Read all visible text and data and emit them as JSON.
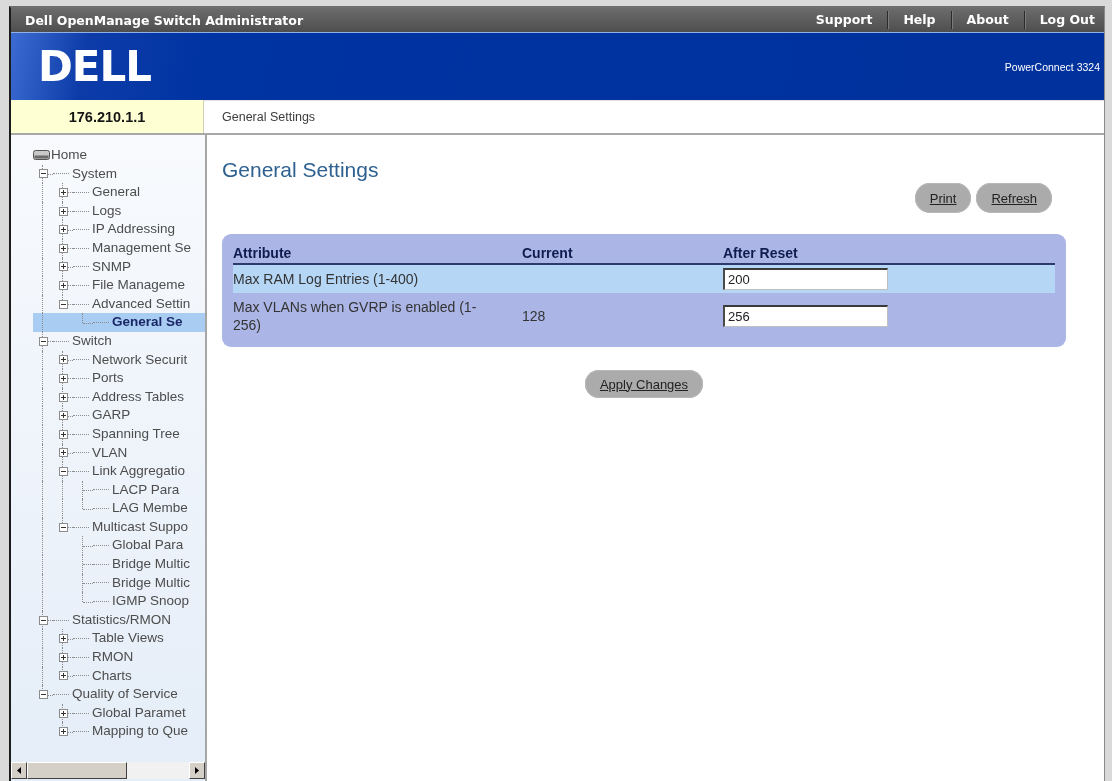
{
  "window": {
    "title": "Dell OpenManage Switch Administrator"
  },
  "header_links": [
    {
      "label": "Support"
    },
    {
      "label": "Help"
    },
    {
      "label": "About"
    },
    {
      "label": "Log Out"
    }
  ],
  "banner": {
    "logo": "DELL",
    "product": "PowerConnect 3324"
  },
  "address_bar": {
    "device": "176.210.1.1",
    "breadcrumb": "General Settings"
  },
  "sidebar": {
    "tree": [
      {
        "label": "Home",
        "selected": false,
        "children": [
          {
            "label": "System",
            "selected": false,
            "expanded": true,
            "children": [
              {
                "label": "General",
                "selected": false,
                "expanded": false
              },
              {
                "label": "Logs",
                "selected": false,
                "expanded": false
              },
              {
                "label": "IP Addressing",
                "selected": false,
                "expanded": false
              },
              {
                "label": "Management Se",
                "selected": false,
                "expanded": false
              },
              {
                "label": "SNMP",
                "selected": false,
                "expanded": false
              },
              {
                "label": "File Manageme",
                "selected": false,
                "expanded": false
              },
              {
                "label": "Advanced Settin",
                "selected": false,
                "expanded": true,
                "children": [
                  {
                    "label": "General Se",
                    "selected": true
                  }
                ]
              }
            ]
          },
          {
            "label": "Switch",
            "selected": false,
            "expanded": true,
            "children": [
              {
                "label": "Network Securit",
                "selected": false,
                "expanded": false
              },
              {
                "label": "Ports",
                "selected": false,
                "expanded": false
              },
              {
                "label": "Address Tables",
                "selected": false,
                "expanded": false
              },
              {
                "label": "GARP",
                "selected": false,
                "expanded": false
              },
              {
                "label": "Spanning Tree",
                "selected": false,
                "expanded": false
              },
              {
                "label": "VLAN",
                "selected": false,
                "expanded": false
              },
              {
                "label": "Link Aggregatio",
                "selected": false,
                "expanded": true,
                "children": [
                  {
                    "label": "LACP Para",
                    "selected": false
                  },
                  {
                    "label": "LAG Membe",
                    "selected": false
                  }
                ]
              },
              {
                "label": "Multicast Suppo",
                "selected": false,
                "expanded": true,
                "children": [
                  {
                    "label": "Global Para",
                    "selected": false
                  },
                  {
                    "label": "Bridge Multic",
                    "selected": false
                  },
                  {
                    "label": "Bridge Multic",
                    "selected": false
                  },
                  {
                    "label": "IGMP Snoop",
                    "selected": false
                  }
                ]
              }
            ]
          },
          {
            "label": "Statistics/RMON",
            "selected": false,
            "expanded": true,
            "children": [
              {
                "label": "Table Views",
                "selected": false,
                "expanded": false
              },
              {
                "label": "RMON",
                "selected": false,
                "expanded": false
              },
              {
                "label": "Charts",
                "selected": false,
                "expanded": false
              }
            ]
          },
          {
            "label": "Quality of Service",
            "selected": false,
            "expanded": true,
            "children": [
              {
                "label": "Global Paramet",
                "selected": false,
                "expanded": false
              },
              {
                "label": "Mapping to Que",
                "selected": false,
                "expanded": false
              }
            ]
          }
        ]
      }
    ]
  },
  "page": {
    "title": "General Settings",
    "buttons": [
      {
        "label": "Print"
      },
      {
        "label": "Refresh"
      }
    ],
    "table": {
      "columns": [
        "Attribute",
        "Current",
        "After Reset"
      ],
      "rows": [
        {
          "attribute": "Max RAM Log Entries (1-400)",
          "after_reset": "200"
        },
        {
          "attribute": "Max VLANs when GVRP is enabled (1-256)",
          "current": "128",
          "after_reset": "256"
        }
      ]
    },
    "apply_button": "Apply Changes"
  }
}
